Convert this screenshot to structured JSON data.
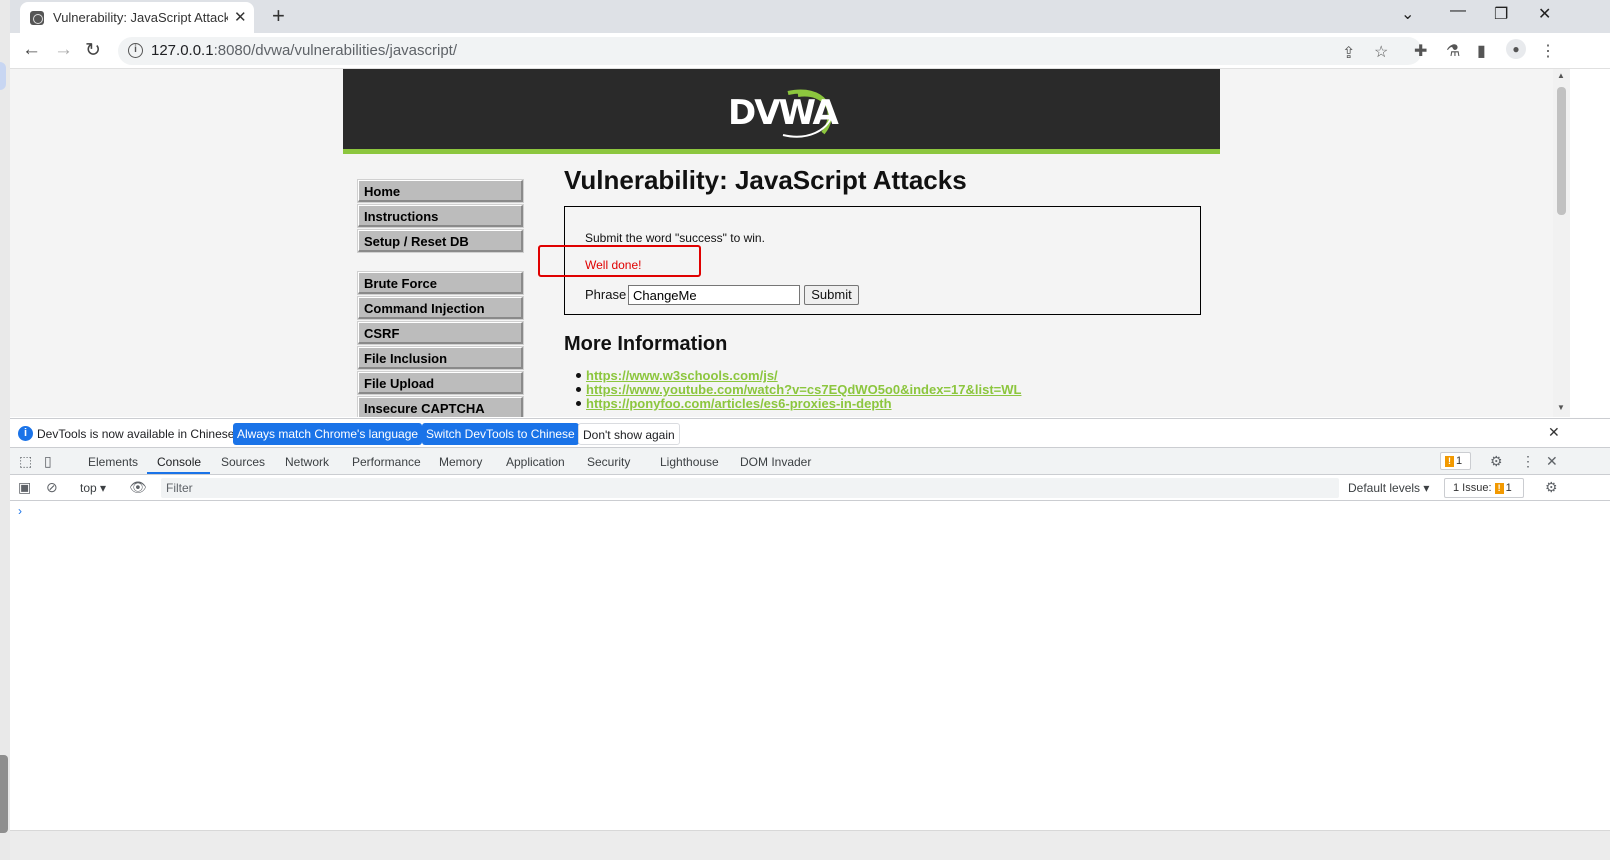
{
  "browser": {
    "tab_title": "Vulnerability: JavaScript Attacks",
    "new_tab": "+",
    "url_host": "127.0.0.1",
    "url_rest": ":8080/dvwa/vulnerabilities/javascript/"
  },
  "dvwa": {
    "logo": "DVWA",
    "menu": [
      "Home",
      "Instructions",
      "Setup / Reset DB",
      "Brute Force",
      "Command Injection",
      "CSRF",
      "File Inclusion",
      "File Upload",
      "Insecure CAPTCHA"
    ],
    "heading": "Vulnerability: JavaScript Attacks",
    "instruction": "Submit the word \"success\" to win.",
    "message": "Well done!",
    "message_color": "#e00000",
    "phrase_label": "Phrase",
    "phrase_value": "ChangeMe",
    "submit_label": "Submit",
    "more_info": "More Information",
    "links": [
      "https://www.w3schools.com/js/",
      "https://www.youtube.com/watch?v=cs7EQdWO5o0&index=17&list=WL",
      "https://ponyfoo.com/articles/es6-proxies-in-depth"
    ],
    "accent_color": "#8cc63e"
  },
  "devtools": {
    "notice": "DevTools is now available in Chinese!",
    "btn_match": "Always match Chrome's language",
    "btn_switch": "Switch DevTools to Chinese",
    "btn_dismiss": "Don't show again",
    "tabs": [
      "Elements",
      "Console",
      "Sources",
      "Network",
      "Performance",
      "Memory",
      "Application",
      "Security",
      "Lighthouse",
      "DOM Invader"
    ],
    "issue_count": "1",
    "context": "top",
    "filter_placeholder": "Filter",
    "levels": "Default levels",
    "issues_label": "1 Issue:",
    "issues_count": "1",
    "prompt": "›"
  }
}
